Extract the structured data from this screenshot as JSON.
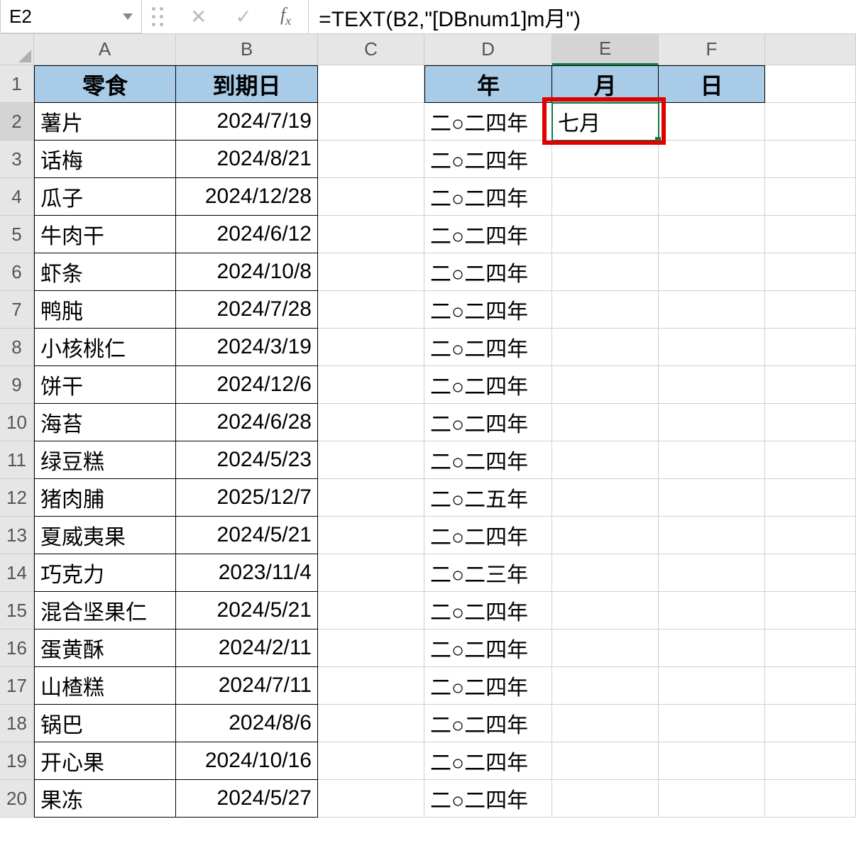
{
  "name_box": "E2",
  "formula": "=TEXT(B2,\"[DBnum1]m月\")",
  "columns": [
    "A",
    "B",
    "C",
    "D",
    "E",
    "F"
  ],
  "row_numbers": [
    1,
    2,
    3,
    4,
    5,
    6,
    7,
    8,
    9,
    10,
    11,
    12,
    13,
    14,
    15,
    16,
    17,
    18,
    19,
    20
  ],
  "headers": {
    "A": "零食",
    "B": "到期日",
    "C": "",
    "D": "年",
    "E": "月",
    "F": "日"
  },
  "rows": [
    {
      "A": "薯片",
      "B": "2024/7/19",
      "C": "",
      "D": "二○二四年",
      "E": "七月",
      "F": ""
    },
    {
      "A": "话梅",
      "B": "2024/8/21",
      "C": "",
      "D": "二○二四年",
      "E": "",
      "F": ""
    },
    {
      "A": "瓜子",
      "B": "2024/12/28",
      "C": "",
      "D": "二○二四年",
      "E": "",
      "F": ""
    },
    {
      "A": "牛肉干",
      "B": "2024/6/12",
      "C": "",
      "D": "二○二四年",
      "E": "",
      "F": ""
    },
    {
      "A": "虾条",
      "B": "2024/10/8",
      "C": "",
      "D": "二○二四年",
      "E": "",
      "F": ""
    },
    {
      "A": "鸭肫",
      "B": "2024/7/28",
      "C": "",
      "D": "二○二四年",
      "E": "",
      "F": ""
    },
    {
      "A": "小核桃仁",
      "B": "2024/3/19",
      "C": "",
      "D": "二○二四年",
      "E": "",
      "F": ""
    },
    {
      "A": "饼干",
      "B": "2024/12/6",
      "C": "",
      "D": "二○二四年",
      "E": "",
      "F": ""
    },
    {
      "A": "海苔",
      "B": "2024/6/28",
      "C": "",
      "D": "二○二四年",
      "E": "",
      "F": ""
    },
    {
      "A": "绿豆糕",
      "B": "2024/5/23",
      "C": "",
      "D": "二○二四年",
      "E": "",
      "F": ""
    },
    {
      "A": "猪肉脯",
      "B": "2025/12/7",
      "C": "",
      "D": "二○二五年",
      "E": "",
      "F": ""
    },
    {
      "A": "夏威夷果",
      "B": "2024/5/21",
      "C": "",
      "D": "二○二四年",
      "E": "",
      "F": ""
    },
    {
      "A": "巧克力",
      "B": "2023/11/4",
      "C": "",
      "D": "二○二三年",
      "E": "",
      "F": ""
    },
    {
      "A": "混合坚果仁",
      "B": "2024/5/21",
      "C": "",
      "D": "二○二四年",
      "E": "",
      "F": ""
    },
    {
      "A": "蛋黄酥",
      "B": "2024/2/11",
      "C": "",
      "D": "二○二四年",
      "E": "",
      "F": ""
    },
    {
      "A": "山楂糕",
      "B": "2024/7/11",
      "C": "",
      "D": "二○二四年",
      "E": "",
      "F": ""
    },
    {
      "A": "锅巴",
      "B": "2024/8/6",
      "C": "",
      "D": "二○二四年",
      "E": "",
      "F": ""
    },
    {
      "A": "开心果",
      "B": "2024/10/16",
      "C": "",
      "D": "二○二四年",
      "E": "",
      "F": ""
    },
    {
      "A": "果冻",
      "B": "2024/5/27",
      "C": "",
      "D": "二○二四年",
      "E": "",
      "F": ""
    }
  ],
  "active_cell": "E2",
  "highlight_cell": "E2"
}
